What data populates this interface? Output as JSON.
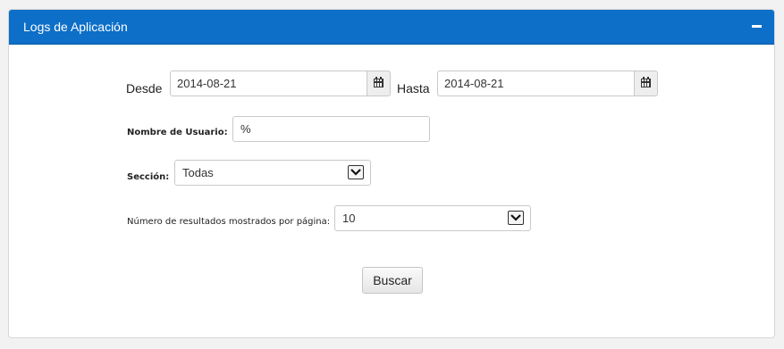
{
  "panel": {
    "title": "Logs de Aplicación",
    "collapse_icon": "minus-icon"
  },
  "filters": {
    "desde_label": "Desde",
    "desde_value": "2014-08-21",
    "hasta_label": "Hasta",
    "hasta_value": "2014-08-21",
    "calendar_icon": "calendar-icon",
    "usuario_label": "Nombre de Usuario:",
    "usuario_value": "%",
    "seccion_label": "Sección:",
    "seccion_value": "Todas",
    "resultados_label": "Número de resultados mostrados por página:",
    "resultados_value": "10",
    "dropdown_icon": "chevron-down-icon"
  },
  "actions": {
    "buscar_label": "Buscar"
  },
  "colors": {
    "header": "#0d6fc7",
    "header_text": "#ffffff"
  }
}
